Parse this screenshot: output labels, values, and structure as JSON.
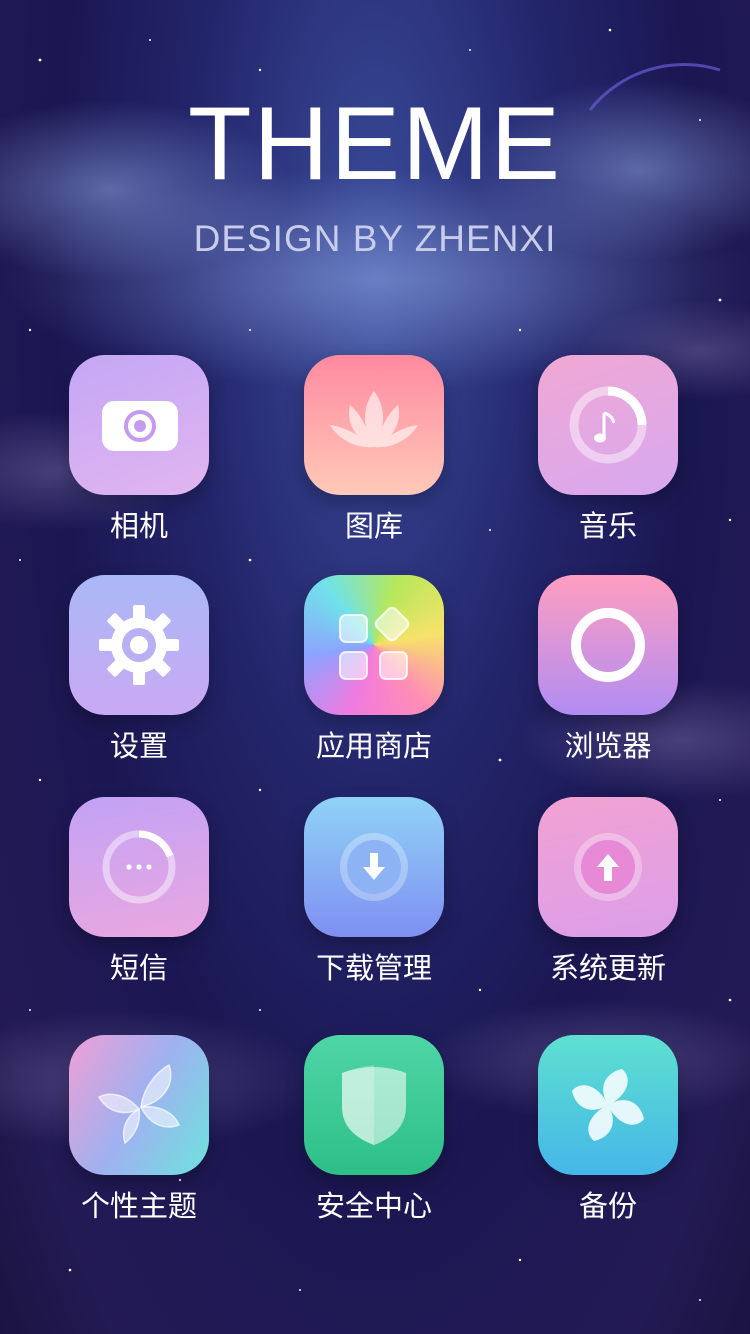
{
  "header": {
    "title": "THEME",
    "subtitle": "DESIGN BY ZHENXI"
  },
  "apps": [
    {
      "label": "相机",
      "icon": "camera-icon"
    },
    {
      "label": "图库",
      "icon": "lotus-icon"
    },
    {
      "label": "音乐",
      "icon": "music-note-icon"
    },
    {
      "label": "设置",
      "icon": "gear-icon"
    },
    {
      "label": "应用商店",
      "icon": "app-store-icon"
    },
    {
      "label": "浏览器",
      "icon": "browser-ring-icon"
    },
    {
      "label": "短信",
      "icon": "message-dots-icon"
    },
    {
      "label": "下载管理",
      "icon": "download-arrow-icon"
    },
    {
      "label": "系统更新",
      "icon": "upload-arrow-icon"
    },
    {
      "label": "个性主题",
      "icon": "butterfly-icon"
    },
    {
      "label": "安全中心",
      "icon": "shield-icon"
    },
    {
      "label": "备份",
      "icon": "pinwheel-icon"
    }
  ],
  "colors": {
    "background": "#1f1b57",
    "label_text": "#ffffff",
    "subtitle_text": "#c8cdeb"
  }
}
